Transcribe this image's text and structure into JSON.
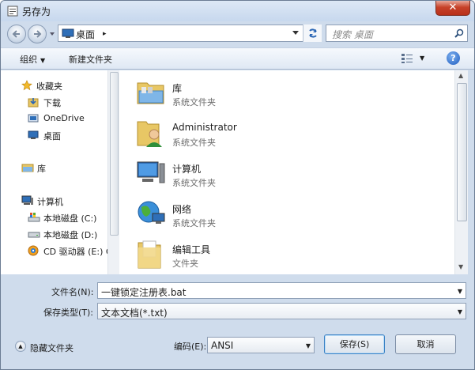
{
  "window": {
    "title": "另存为",
    "close_glyph": "✕"
  },
  "address": {
    "location": "桌面",
    "separator": "▸",
    "search_placeholder": "搜索 桌面"
  },
  "toolbar": {
    "organize_label": "组织",
    "organize_caret": "▼",
    "new_folder_label": "新建文件夹",
    "view_caret": "▼",
    "help_glyph": "?"
  },
  "navpane": {
    "items": [
      {
        "label": "收藏夹",
        "icon": "star-icon"
      },
      {
        "label": "下载",
        "icon": "download-folder-icon"
      },
      {
        "label": "OneDrive",
        "icon": "onedrive-icon"
      },
      {
        "label": "桌面",
        "icon": "desktop-icon"
      },
      {
        "label": "库",
        "icon": "library-icon"
      },
      {
        "label": "计算机",
        "icon": "computer-icon"
      },
      {
        "label": "本地磁盘 (C:)",
        "icon": "drive-windows-icon"
      },
      {
        "label": "本地磁盘 (D:)",
        "icon": "drive-icon"
      },
      {
        "label": "CD 驱动器 (E:) C",
        "icon": "cd-drive-icon"
      }
    ]
  },
  "files": [
    {
      "name": "库",
      "type": "系统文件夹",
      "icon": "library-folder-icon"
    },
    {
      "name": "Administrator",
      "type": "系统文件夹",
      "icon": "user-folder-icon"
    },
    {
      "name": "计算机",
      "type": "系统文件夹",
      "icon": "computer-icon"
    },
    {
      "name": "网络",
      "type": "系统文件夹",
      "icon": "network-icon"
    },
    {
      "name": "编辑工具",
      "type": "文件夹",
      "icon": "folder-icon"
    }
  ],
  "form": {
    "filename_label": "文件名(N):",
    "filename_value": "一键锁定注册表.bat",
    "filetype_label": "保存类型(T):",
    "filetype_value": "文本文档(*.txt)",
    "drop_glyph": "▼"
  },
  "footer": {
    "hide_folders_label": "隐藏文件夹",
    "hide_glyph": "▲",
    "encoding_label": "编码(E):",
    "encoding_value": "ANSI",
    "save_label": "保存(S)",
    "cancel_label": "取消"
  }
}
